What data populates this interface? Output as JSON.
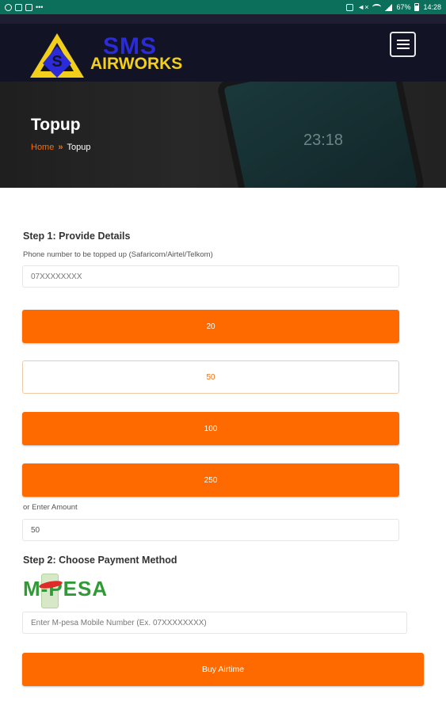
{
  "status_bar": {
    "battery": "67%",
    "time": "14:28"
  },
  "header": {
    "logo_line1": "SMS",
    "logo_line2": "AIRWORKS"
  },
  "banner": {
    "title": "Topup",
    "breadcrumb": {
      "home": "Home",
      "separator": "»",
      "current": "Topup"
    },
    "decor_time": "23:18"
  },
  "step1": {
    "title": "Step 1: Provide Details",
    "phone_label": "Phone number to be topped up (Safaricom/Airtel/Telkom)",
    "phone_placeholder": "07XXXXXXXX",
    "amounts": [
      "20",
      "50",
      "100",
      "250"
    ],
    "selected_amount": "50",
    "custom_amount_label": "or Enter Amount",
    "custom_amount_value": "50"
  },
  "step2": {
    "title": "Step 2: Choose Payment Method",
    "mpesa_logo_text": "M-PESA",
    "mpesa_placeholder": "Enter M-pesa Mobile Number (Ex. 07XXXXXXXX)"
  },
  "submit": {
    "label": "Buy Airtime"
  },
  "colors": {
    "accent": "#ff6a00",
    "header_bg": "#131326",
    "status_bar": "#0b6f5c",
    "mpesa_green": "#2f9a36"
  }
}
